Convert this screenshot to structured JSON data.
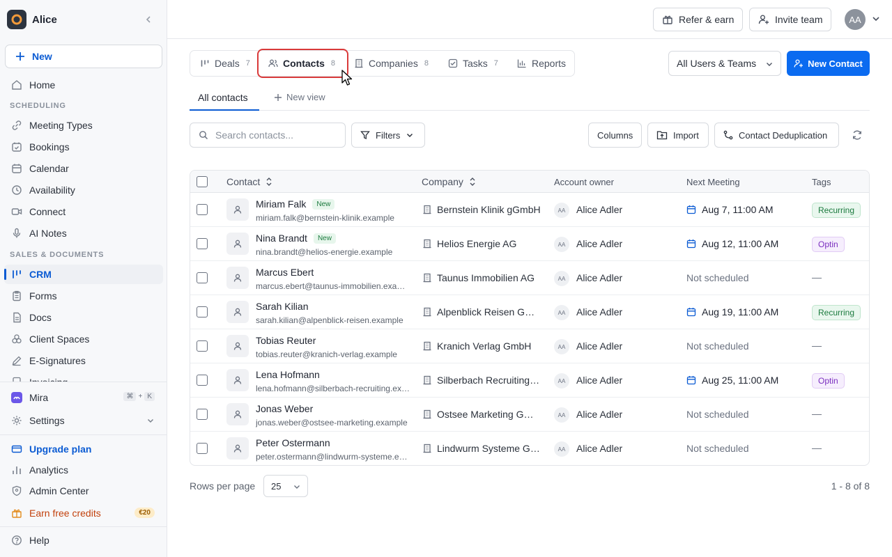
{
  "workspace": {
    "name": "Alice"
  },
  "sidebar": {
    "new_label": "New",
    "home": "Home",
    "scheduling_label": "SCHEDULING",
    "scheduling": [
      "Meeting Types",
      "Bookings",
      "Calendar",
      "Availability",
      "Connect",
      "AI Notes"
    ],
    "sales_label": "SALES & DOCUMENTS",
    "sales": [
      "CRM",
      "Forms",
      "Docs",
      "Client Spaces",
      "E-Signatures",
      "Invoicing"
    ],
    "active": "CRM",
    "mira": "Mira",
    "mira_shortcut": [
      "⌘",
      "+",
      "K"
    ],
    "settings": "Settings",
    "upgrade": "Upgrade plan",
    "analytics": "Analytics",
    "admin": "Admin Center",
    "earn": "Earn free credits",
    "earn_badge": "€20",
    "help": "Help"
  },
  "header": {
    "refer": "Refer & earn",
    "invite": "Invite team",
    "avatar_initials": "AA"
  },
  "tabs": [
    {
      "label": "Deals",
      "count": "7",
      "icon": "pipeline-icon"
    },
    {
      "label": "Contacts",
      "count": "8",
      "icon": "contacts-icon"
    },
    {
      "label": "Companies",
      "count": "8",
      "icon": "building-icon"
    },
    {
      "label": "Tasks",
      "count": "7",
      "icon": "checkbox-icon"
    },
    {
      "label": "Reports",
      "count": "",
      "icon": "bar-chart-icon"
    }
  ],
  "active_tab": "Contacts",
  "filter_select": "All Users & Teams",
  "new_contact": "New Contact",
  "views": {
    "all": "All contacts",
    "new_view": "New view"
  },
  "toolbar": {
    "search_placeholder": "Search contacts...",
    "filters": "Filters",
    "columns": "Columns",
    "import": "Import",
    "dedup": "Contact Deduplication"
  },
  "table": {
    "headers": {
      "contact": "Contact",
      "company": "Company",
      "owner": "Account owner",
      "meeting": "Next Meeting",
      "tags": "Tags"
    },
    "rows": [
      {
        "name": "Miriam Falk",
        "badge": "New",
        "email": "miriam.falk@bernstein-klinik.example",
        "company": "Bernstein Klinik gGmbH",
        "owner": "Alice Adler",
        "owner_initials": "AA",
        "meeting": "Aug 7, 11:00 AM",
        "tag": "Recurring"
      },
      {
        "name": "Nina Brandt",
        "badge": "New",
        "email": "nina.brandt@helios-energie.example",
        "company": "Helios Energie AG",
        "owner": "Alice Adler",
        "owner_initials": "AA",
        "meeting": "Aug 12, 11:00 AM",
        "tag": "Optin"
      },
      {
        "name": "Marcus Ebert",
        "badge": "",
        "email": "marcus.ebert@taunus-immobilien.example",
        "company": "Taunus Immobilien AG",
        "owner": "Alice Adler",
        "owner_initials": "AA",
        "meeting": "Not scheduled",
        "tag": "—"
      },
      {
        "name": "Sarah Kilian",
        "badge": "",
        "email": "sarah.kilian@alpenblick-reisen.example",
        "company": "Alpenblick Reisen GmbH",
        "owner": "Alice Adler",
        "owner_initials": "AA",
        "meeting": "Aug 19, 11:00 AM",
        "tag": "Recurring"
      },
      {
        "name": "Tobias Reuter",
        "badge": "",
        "email": "tobias.reuter@kranich-verlag.example",
        "company": "Kranich Verlag GmbH",
        "owner": "Alice Adler",
        "owner_initials": "AA",
        "meeting": "Not scheduled",
        "tag": "—"
      },
      {
        "name": "Lena Hofmann",
        "badge": "",
        "email": "lena.hofmann@silberbach-recruiting.example",
        "company": "Silberbach Recruiting GmbH",
        "owner": "Alice Adler",
        "owner_initials": "AA",
        "meeting": "Aug 25, 11:00 AM",
        "tag": "Optin"
      },
      {
        "name": "Jonas Weber",
        "badge": "",
        "email": "jonas.weber@ostsee-marketing.example",
        "company": "Ostsee Marketing GmbH",
        "owner": "Alice Adler",
        "owner_initials": "AA",
        "meeting": "Not scheduled",
        "tag": "—"
      },
      {
        "name": "Peter Ostermann",
        "badge": "",
        "email": "peter.ostermann@lindwurm-systeme.example",
        "company": "Lindwurm Systeme GmbH",
        "owner": "Alice Adler",
        "owner_initials": "AA",
        "meeting": "Not scheduled",
        "tag": "—"
      }
    ]
  },
  "footer": {
    "rows_label": "Rows per page",
    "rows_value": "25",
    "range": "1 - 8 of 8"
  },
  "colors": {
    "accent": "#0b5bd3",
    "primary_button": "#0b6bf0",
    "highlight": "#d93a3a"
  }
}
